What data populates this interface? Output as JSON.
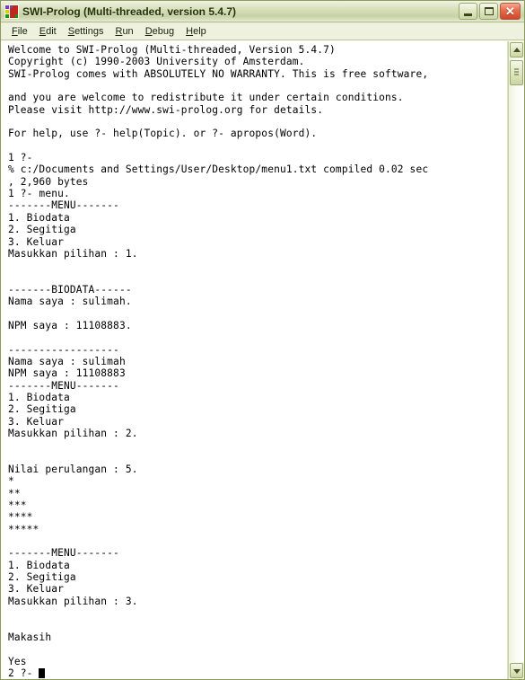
{
  "window": {
    "title": "SWI-Prolog (Multi-threaded, version 5.4.7)",
    "icon": "swi-prolog-icon",
    "colors": {
      "titlebar_start": "#f2f4e2",
      "titlebar_end": "#c8d2a4",
      "frame_border": "#8d9a60",
      "menubar_bg": "#eef1de",
      "console_bg": "#ffffff",
      "console_fg": "#000000",
      "close_button": "#cf452a"
    },
    "buttons": {
      "minimize": {
        "name": "minimize-button",
        "glyph": "_"
      },
      "maximize": {
        "name": "maximize-button",
        "glyph": "□"
      },
      "close": {
        "name": "close-button",
        "glyph": "✕"
      }
    }
  },
  "menubar": {
    "items": [
      {
        "label": "File",
        "accel": "F"
      },
      {
        "label": "Edit",
        "accel": "E"
      },
      {
        "label": "Settings",
        "accel": "S"
      },
      {
        "label": "Run",
        "accel": "R"
      },
      {
        "label": "Debug",
        "accel": "D"
      },
      {
        "label": "Help",
        "accel": "H"
      }
    ]
  },
  "console": {
    "prompt_current": "2 ?- ",
    "cursor": "block",
    "text": "Welcome to SWI-Prolog (Multi-threaded, Version 5.4.7)\nCopyright (c) 1990-2003 University of Amsterdam.\nSWI-Prolog comes with ABSOLUTELY NO WARRANTY. This is free software,\n\nand you are welcome to redistribute it under certain conditions.\nPlease visit http://www.swi-prolog.org for details.\n\nFor help, use ?- help(Topic). or ?- apropos(Word).\n\n1 ?-\n% c:/Documents and Settings/User/Desktop/menu1.txt compiled 0.02 sec\n, 2,960 bytes\n1 ?- menu.\n-------MENU-------\n1. Biodata\n2. Segitiga\n3. Keluar\nMasukkan pilihan : 1.\n\n\n-------BIODATA------\nNama saya : sulimah.\n\nNPM saya : 11108883.\n\n------------------\nNama saya : sulimah\nNPM saya : 11108883\n-------MENU-------\n1. Biodata\n2. Segitiga\n3. Keluar\nMasukkan pilihan : 2.\n\n\nNilai perulangan : 5.\n*\n**\n***\n****\n*****\n\n-------MENU-------\n1. Biodata\n2. Segitiga\n3. Keluar\nMasukkan pilihan : 3.\n\n\nMakasih\n\nYes\n2 ?- "
  },
  "scrollbar": {
    "up_label": "▲",
    "down_label": "▼",
    "thumb_position_percent": 0
  }
}
